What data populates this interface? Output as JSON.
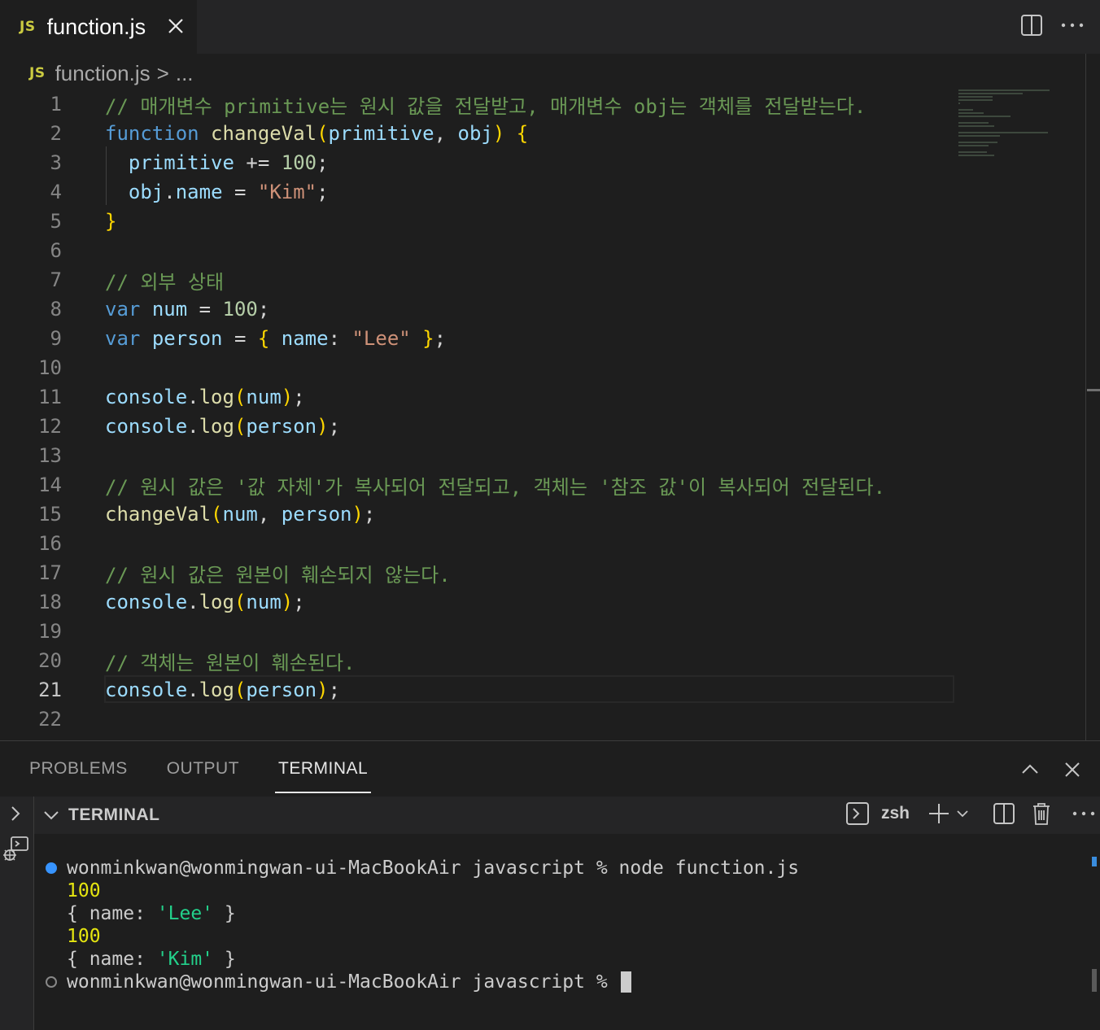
{
  "tab": {
    "badge": "JS",
    "title": "function.js"
  },
  "breadcrumb": {
    "badge": "JS",
    "file": "function.js",
    "separator": ">",
    "more": "..."
  },
  "editor": {
    "active_line": 21,
    "lines": [
      {
        "n": "1",
        "tokens": [
          [
            "c-com",
            "// 매개변수 primitive는 원시 값을 전달받고, 매개변수 obj는 객체를 전달받는다."
          ]
        ]
      },
      {
        "n": "2",
        "tokens": [
          [
            "c-kw",
            "function"
          ],
          [
            "c-pl",
            " "
          ],
          [
            "c-fn",
            "changeVal"
          ],
          [
            "c-p1",
            "("
          ],
          [
            "c-var",
            "primitive"
          ],
          [
            "c-pl",
            ", "
          ],
          [
            "c-var",
            "obj"
          ],
          [
            "c-p1",
            ")"
          ],
          [
            "c-pl",
            " "
          ],
          [
            "c-p1",
            "{"
          ]
        ]
      },
      {
        "n": "3",
        "tokens": [
          [
            "c-pl",
            "  "
          ],
          [
            "c-var",
            "primitive"
          ],
          [
            "c-pl",
            " += "
          ],
          [
            "c-num",
            "100"
          ],
          [
            "c-pl",
            ";"
          ]
        ]
      },
      {
        "n": "4",
        "tokens": [
          [
            "c-pl",
            "  "
          ],
          [
            "c-var",
            "obj"
          ],
          [
            "c-pl",
            "."
          ],
          [
            "c-var",
            "name"
          ],
          [
            "c-pl",
            " = "
          ],
          [
            "c-str",
            "\"Kim\""
          ],
          [
            "c-pl",
            ";"
          ]
        ]
      },
      {
        "n": "5",
        "tokens": [
          [
            "c-p1",
            "}"
          ]
        ]
      },
      {
        "n": "6",
        "tokens": []
      },
      {
        "n": "7",
        "tokens": [
          [
            "c-com",
            "// 외부 상태"
          ]
        ]
      },
      {
        "n": "8",
        "tokens": [
          [
            "c-kw",
            "var"
          ],
          [
            "c-pl",
            " "
          ],
          [
            "c-var",
            "num"
          ],
          [
            "c-pl",
            " = "
          ],
          [
            "c-num",
            "100"
          ],
          [
            "c-pl",
            ";"
          ]
        ]
      },
      {
        "n": "9",
        "tokens": [
          [
            "c-kw",
            "var"
          ],
          [
            "c-pl",
            " "
          ],
          [
            "c-var",
            "person"
          ],
          [
            "c-pl",
            " = "
          ],
          [
            "c-p1",
            "{"
          ],
          [
            "c-pl",
            " "
          ],
          [
            "c-var",
            "name"
          ],
          [
            "c-pl",
            ": "
          ],
          [
            "c-str",
            "\"Lee\""
          ],
          [
            "c-pl",
            " "
          ],
          [
            "c-p1",
            "}"
          ],
          [
            "c-pl",
            ";"
          ]
        ]
      },
      {
        "n": "10",
        "tokens": []
      },
      {
        "n": "11",
        "tokens": [
          [
            "c-var",
            "console"
          ],
          [
            "c-pl",
            "."
          ],
          [
            "c-fn",
            "log"
          ],
          [
            "c-p1",
            "("
          ],
          [
            "c-var",
            "num"
          ],
          [
            "c-p1",
            ")"
          ],
          [
            "c-pl",
            ";"
          ]
        ]
      },
      {
        "n": "12",
        "tokens": [
          [
            "c-var",
            "console"
          ],
          [
            "c-pl",
            "."
          ],
          [
            "c-fn",
            "log"
          ],
          [
            "c-p1",
            "("
          ],
          [
            "c-var",
            "person"
          ],
          [
            "c-p1",
            ")"
          ],
          [
            "c-pl",
            ";"
          ]
        ]
      },
      {
        "n": "13",
        "tokens": []
      },
      {
        "n": "14",
        "tokens": [
          [
            "c-com",
            "// 원시 값은 '값 자체'가 복사되어 전달되고, 객체는 '참조 값'이 복사되어 전달된다."
          ]
        ]
      },
      {
        "n": "15",
        "tokens": [
          [
            "c-fn",
            "changeVal"
          ],
          [
            "c-p1",
            "("
          ],
          [
            "c-var",
            "num"
          ],
          [
            "c-pl",
            ", "
          ],
          [
            "c-var",
            "person"
          ],
          [
            "c-p1",
            ")"
          ],
          [
            "c-pl",
            ";"
          ]
        ]
      },
      {
        "n": "16",
        "tokens": []
      },
      {
        "n": "17",
        "tokens": [
          [
            "c-com",
            "// 원시 값은 원본이 훼손되지 않는다."
          ]
        ]
      },
      {
        "n": "18",
        "tokens": [
          [
            "c-var",
            "console"
          ],
          [
            "c-pl",
            "."
          ],
          [
            "c-fn",
            "log"
          ],
          [
            "c-p1",
            "("
          ],
          [
            "c-var",
            "num"
          ],
          [
            "c-p1",
            ")"
          ],
          [
            "c-pl",
            ";"
          ]
        ]
      },
      {
        "n": "19",
        "tokens": []
      },
      {
        "n": "20",
        "tokens": [
          [
            "c-com",
            "// 객체는 원본이 훼손된다."
          ]
        ]
      },
      {
        "n": "21",
        "tokens": [
          [
            "c-var",
            "console"
          ],
          [
            "c-pl",
            "."
          ],
          [
            "c-fn",
            "log"
          ],
          [
            "c-p1",
            "("
          ],
          [
            "c-var",
            "person"
          ],
          [
            "c-p1",
            ")"
          ],
          [
            "c-pl",
            ";"
          ]
        ]
      },
      {
        "n": "22",
        "tokens": []
      }
    ]
  },
  "panel": {
    "tabs": [
      {
        "label": "PROBLEMS",
        "active": false
      },
      {
        "label": "OUTPUT",
        "active": false
      },
      {
        "label": "TERMINAL",
        "active": true
      }
    ],
    "terminal_header": "TERMINAL",
    "shell": "zsh"
  },
  "terminal": {
    "prompt": "wonminkwan@wonmingwan-ui-MacBookAir javascript % ",
    "command": "node function.js",
    "output": [
      {
        "kind": "num",
        "text": "100"
      },
      {
        "kind": "obj",
        "pre": "{ name: ",
        "val": "'Lee'",
        "post": " }"
      },
      {
        "kind": "num",
        "text": "100"
      },
      {
        "kind": "obj",
        "pre": "{ name: ",
        "val": "'Kim'",
        "post": " }"
      }
    ]
  },
  "colors": {
    "success_dot": "#3794ff",
    "idle_dot": "#888888"
  }
}
